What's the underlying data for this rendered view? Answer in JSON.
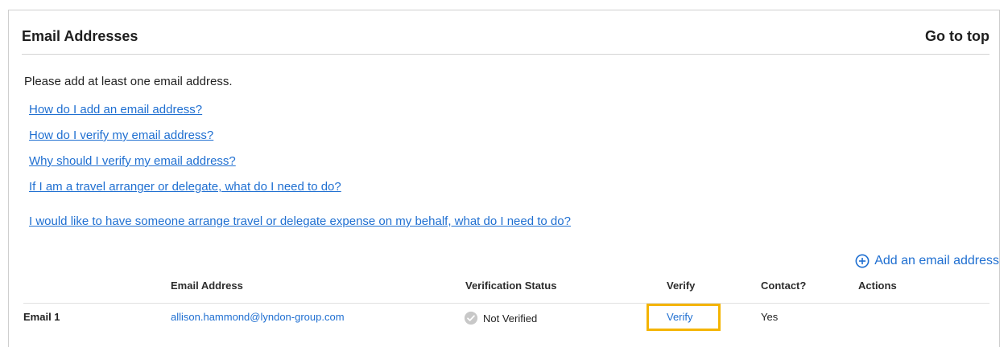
{
  "section": {
    "title": "Email Addresses",
    "go_to_top": "Go to top",
    "intro": "Please add at least one email address."
  },
  "help_links": [
    "How do I add an email address?",
    "How do I verify my email address?",
    "Why should I verify my email address?",
    "If I am a travel arranger or delegate, what do I need to do?",
    "I would like to have someone arrange travel or delegate expense on my behalf, what do I need to do?"
  ],
  "add_email": {
    "label": "Add an email address",
    "icon": "plus-circle-icon"
  },
  "table": {
    "headers": {
      "email": "Email Address",
      "verification_status": "Verification Status",
      "verify": "Verify",
      "contact": "Contact?",
      "actions": "Actions"
    },
    "rows": [
      {
        "label": "Email 1",
        "email": "allison.hammond@lyndon-group.com",
        "verification_status": "Not Verified",
        "verify": "Verify",
        "contact": "Yes",
        "status_icon": "check-circle-icon"
      }
    ]
  },
  "colors": {
    "link": "#1f6fd1",
    "highlight": "#f4b400",
    "text": "#222222",
    "status_icon": "#c8c8c8"
  }
}
